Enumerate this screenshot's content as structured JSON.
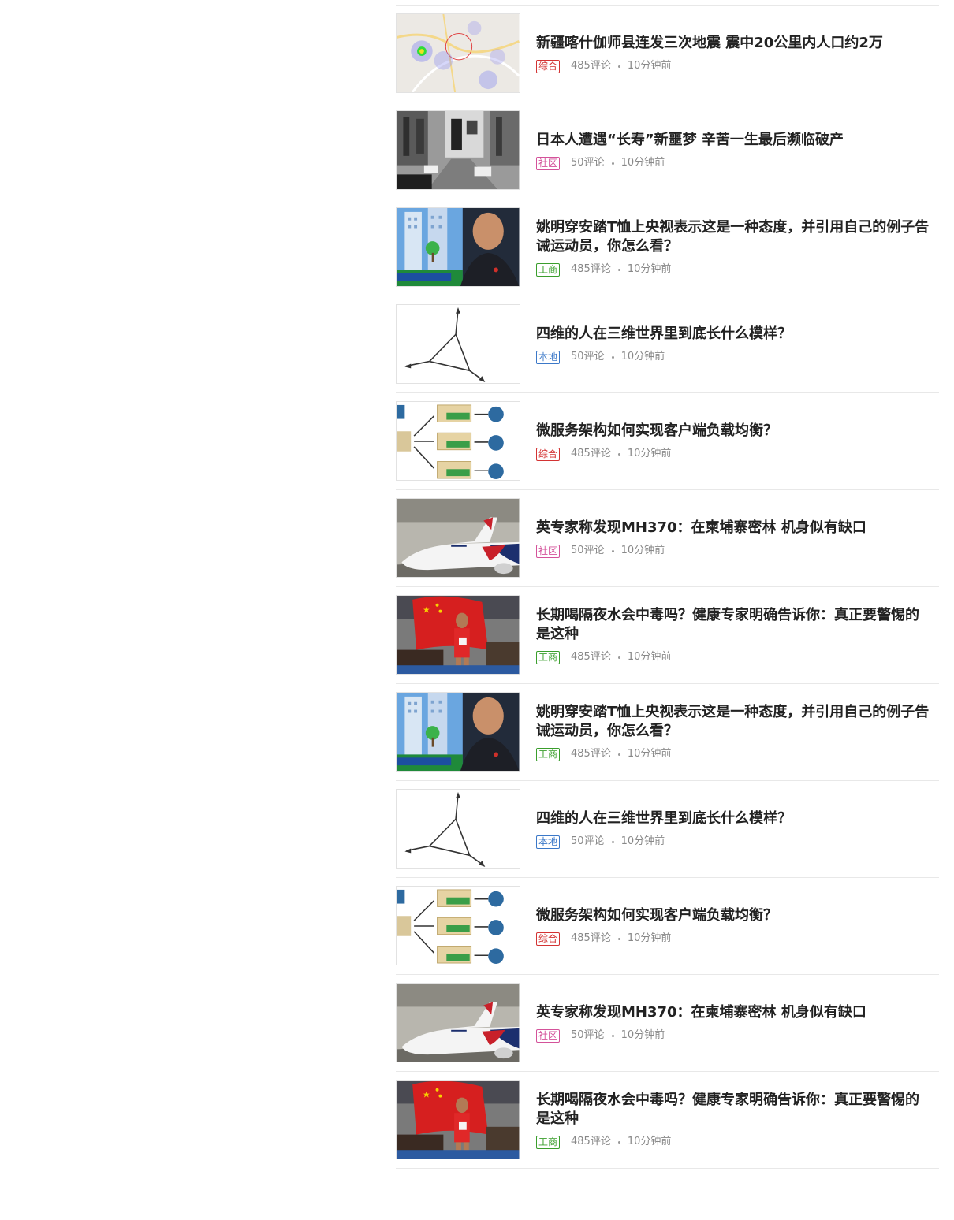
{
  "feed": {
    "items": [
      {
        "title": "新疆喀什伽师县连发三次地震 震中20公里内人口约2万",
        "tag": "综合",
        "tag_color": "#d33333",
        "comments": "485评论",
        "time": "10分钟前",
        "thumb": "map-thumbnail"
      },
      {
        "title": "日本人遭遇“长寿”新噩梦 辛苦一生最后濒临破产",
        "tag": "社区",
        "tag_color": "#d4529a",
        "comments": "50评论",
        "time": "10分钟前",
        "thumb": "city-street-thumbnail"
      },
      {
        "title": "姚明穿安踏T恤上央视表示这是一种态度，并引用自己的例子告诫运动员，你怎么看？",
        "tag": "工商",
        "tag_color": "#3a9e2c",
        "comments": "485评论",
        "time": "10分钟前",
        "thumb": "tv-interview-thumbnail"
      },
      {
        "title": "四维的人在三维世界里到底长什么模样？",
        "tag": "本地",
        "tag_color": "#3b78c8",
        "comments": "50评论",
        "time": "10分钟前",
        "thumb": "axes-diagram-thumbnail"
      },
      {
        "title": "微服务架构如何实现客户端负载均衡？",
        "tag": "综合",
        "tag_color": "#d33333",
        "comments": "485评论",
        "time": "10分钟前",
        "thumb": "architecture-diagram-thumbnail"
      },
      {
        "title": "英专家称发现MH370：在柬埔寨密林 机身似有缺口",
        "tag": "社区",
        "tag_color": "#d4529a",
        "comments": "50评论",
        "time": "10分钟前",
        "thumb": "airplane-thumbnail"
      },
      {
        "title": "长期喝隔夜水会中毒吗？健康专家明确告诉你：真正要警惕的是这种",
        "tag": "工商",
        "tag_color": "#3a9e2c",
        "comments": "485评论",
        "time": "10分钟前",
        "thumb": "athlete-flag-thumbnail"
      },
      {
        "title": "姚明穿安踏T恤上央视表示这是一种态度，并引用自己的例子告诫运动员，你怎么看？",
        "tag": "工商",
        "tag_color": "#3a9e2c",
        "comments": "485评论",
        "time": "10分钟前",
        "thumb": "tv-interview-thumbnail"
      },
      {
        "title": "四维的人在三维世界里到底长什么模样？",
        "tag": "本地",
        "tag_color": "#3b78c8",
        "comments": "50评论",
        "time": "10分钟前",
        "thumb": "axes-diagram-thumbnail"
      },
      {
        "title": "微服务架构如何实现客户端负载均衡？",
        "tag": "综合",
        "tag_color": "#d33333",
        "comments": "485评论",
        "time": "10分钟前",
        "thumb": "architecture-diagram-thumbnail"
      },
      {
        "title": "英专家称发现MH370：在柬埔寨密林 机身似有缺口",
        "tag": "社区",
        "tag_color": "#d4529a",
        "comments": "50评论",
        "time": "10分钟前",
        "thumb": "airplane-thumbnail"
      },
      {
        "title": "长期喝隔夜水会中毒吗？健康专家明确告诉你：真正要警惕的是这种",
        "tag": "工商",
        "tag_color": "#3a9e2c",
        "comments": "485评论",
        "time": "10分钟前",
        "thumb": "athlete-flag-thumbnail"
      }
    ]
  }
}
